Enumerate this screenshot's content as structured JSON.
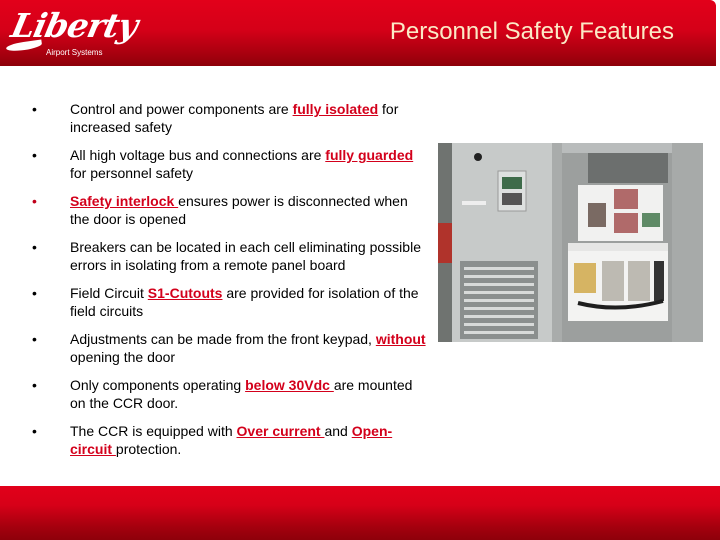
{
  "header": {
    "logo_text": "Liberty",
    "logo_subtext": "Airport Systems",
    "title": "Personnel Safety Features",
    "colors": {
      "bar_top": "#e2001a",
      "bar_bottom": "#8d000a",
      "title": "#fbeac6",
      "highlight": "#d3001b"
    }
  },
  "bullets": [
    {
      "parts": [
        {
          "t": "Control and power components are ",
          "h": false
        },
        {
          "t": "fully isolated",
          "h": true
        },
        {
          "t": " for increased safety",
          "h": false
        }
      ],
      "red_bullet": false
    },
    {
      "parts": [
        {
          "t": "All high voltage bus and connections are ",
          "h": false
        },
        {
          "t": "fully guarded ",
          "h": true
        },
        {
          "t": "for personnel safety",
          "h": false
        }
      ],
      "red_bullet": false
    },
    {
      "parts": [
        {
          "t": "Safety interlock ",
          "h": true
        },
        {
          "t": "ensures power is disconnected when the door is opened",
          "h": false
        }
      ],
      "red_bullet": true
    },
    {
      "parts": [
        {
          "t": "Breakers can be located in each cell eliminating possible errors in isolating from a remote panel board",
          "h": false
        }
      ],
      "red_bullet": false
    },
    {
      "parts": [
        {
          "t": "Field Circuit ",
          "h": false
        },
        {
          "t": "S1-Cutouts",
          "h": true
        },
        {
          "t": " are provided for isolation of the field circuits",
          "h": false
        }
      ],
      "red_bullet": false
    },
    {
      "parts": [
        {
          "t": "Adjustments can be made from the front keypad, ",
          "h": false
        },
        {
          "t": "without",
          "h": true
        },
        {
          "t": " opening the door",
          "h": false
        }
      ],
      "red_bullet": false
    },
    {
      "parts": [
        {
          "t": "Only components operating ",
          "h": false
        },
        {
          "t": "below 30Vdc ",
          "h": true
        },
        {
          "t": "are mounted on the CCR door.",
          "h": false
        }
      ],
      "red_bullet": false
    },
    {
      "parts": [
        {
          "t": "The CCR is equipped with ",
          "h": false
        },
        {
          "t": "Over current ",
          "h": true
        },
        {
          "t": "and ",
          "h": false
        },
        {
          "t": "Open-circuit ",
          "h": true
        },
        {
          "t": "protection.",
          "h": false
        }
      ],
      "red_bullet": false
    }
  ],
  "photo": {
    "subject": "open CCR cabinet with door, breakers, capacitors"
  },
  "bullet_glyph": "•"
}
